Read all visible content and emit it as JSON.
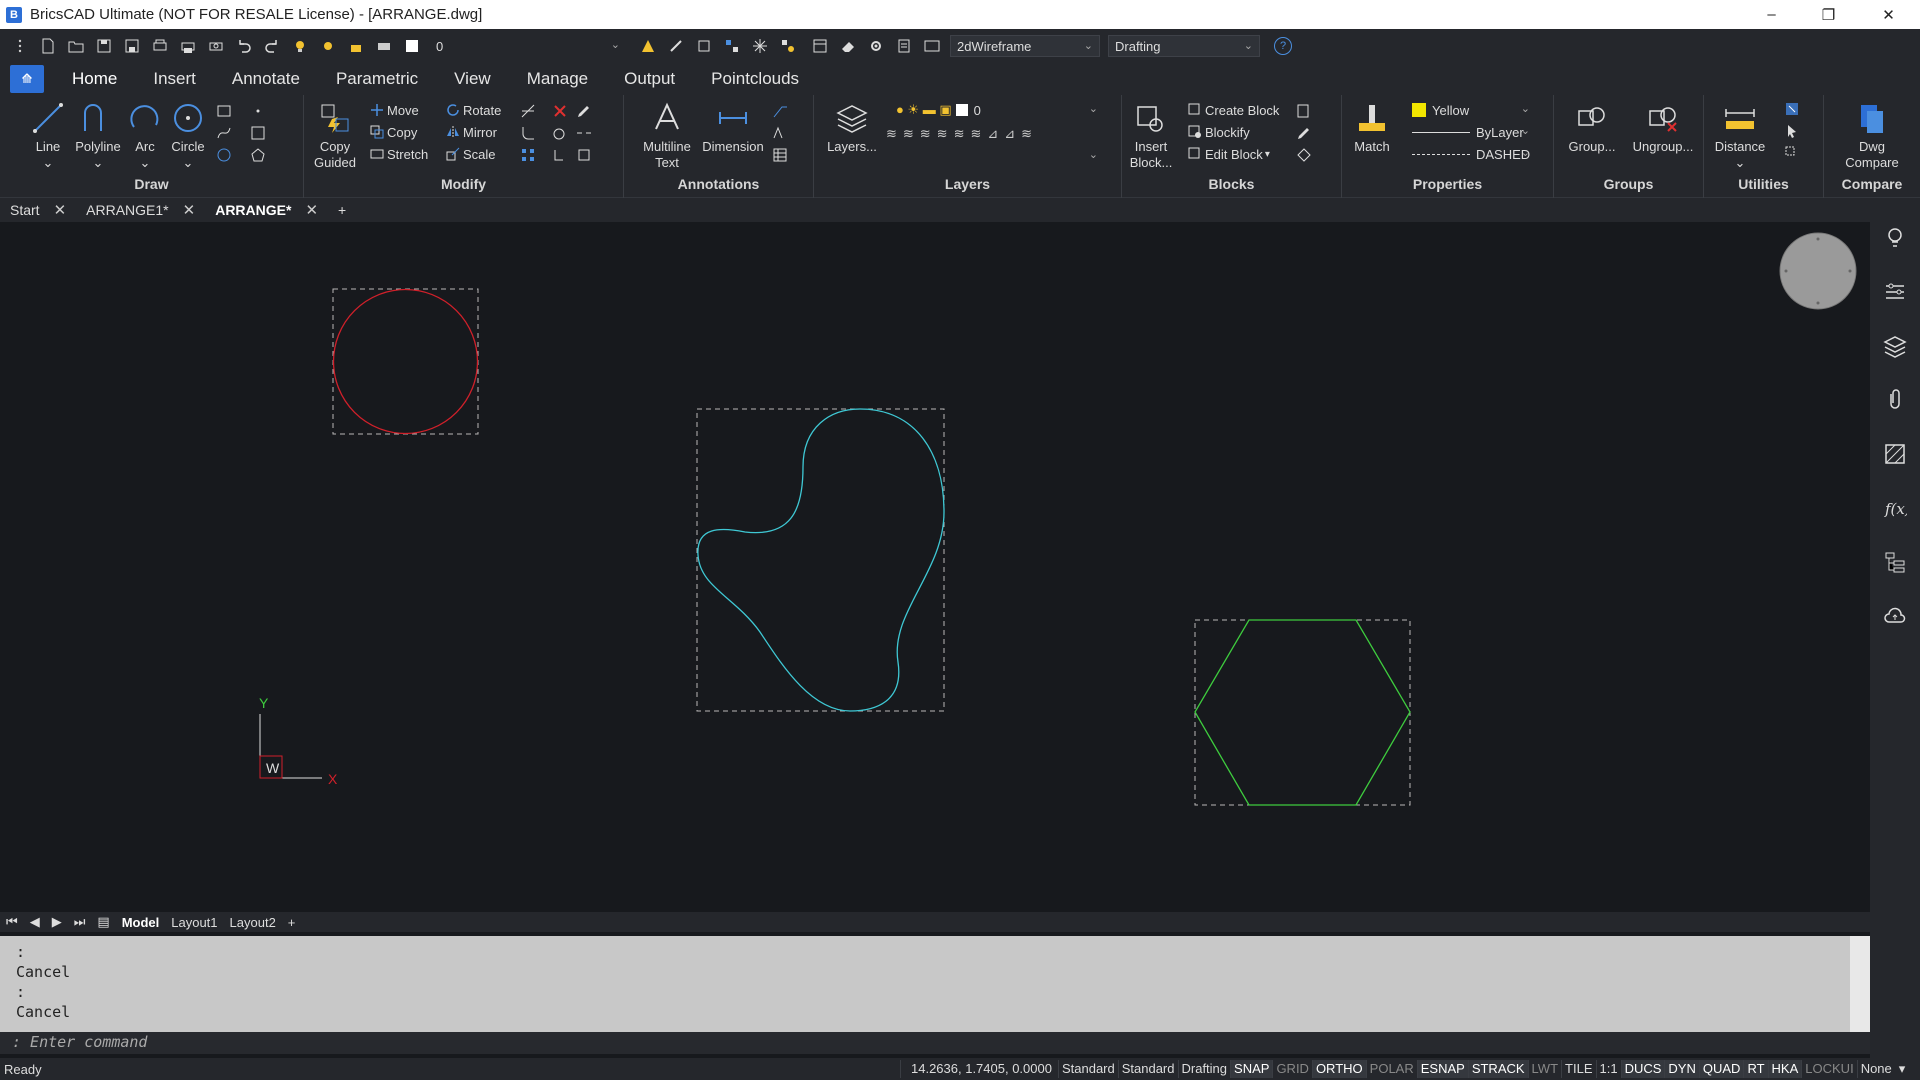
{
  "window": {
    "title": "BricsCAD Ultimate (NOT FOR RESALE License) - [ARRANGE.dwg]",
    "minimize": "–",
    "maximize": "❐",
    "close": "✕"
  },
  "qat": {
    "layer_value": "0",
    "visual_style": "2dWireframe",
    "workspace": "Drafting",
    "help": "?"
  },
  "menu": {
    "tabs": [
      "Home",
      "Insert",
      "Annotate",
      "Parametric",
      "View",
      "Manage",
      "Output",
      "Pointclouds"
    ]
  },
  "ribbon": {
    "draw": {
      "label": "Draw",
      "line": "Line",
      "polyline": "Polyline",
      "arc": "Arc",
      "circle": "Circle"
    },
    "modify": {
      "label": "Modify",
      "copy_guided": "Copy\nGuided",
      "move": "Move",
      "copy": "Copy",
      "stretch": "Stretch",
      "rotate": "Rotate",
      "mirror": "Mirror",
      "scale": "Scale"
    },
    "annotations": {
      "label": "Annotations",
      "mtext": "Multiline\nText",
      "dimension": "Dimension"
    },
    "layers": {
      "label": "Layers",
      "layers_btn": "Layers...",
      "layer_value": "0"
    },
    "blocks": {
      "label": "Blocks",
      "insert": "Insert\nBlock...",
      "create": "Create Block",
      "blockify": "Blockify",
      "edit": "Edit Block"
    },
    "properties": {
      "label": "Properties",
      "match": "Match",
      "color": "Yellow",
      "lineweight": "ByLayer",
      "linetype": "DASHED"
    },
    "groups": {
      "label": "Groups",
      "group": "Group...",
      "ungroup": "Ungroup..."
    },
    "utilities": {
      "label": "Utilities",
      "distance": "Distance"
    },
    "compare": {
      "label": "Compare",
      "dwg_compare": "Dwg\nCompare"
    }
  },
  "doc_tabs": [
    {
      "label": "Start",
      "close": "✕"
    },
    {
      "label": "ARRANGE1*",
      "close": "✕"
    },
    {
      "label": "ARRANGE*",
      "close": "✕"
    }
  ],
  "doc_tab_add": "+",
  "ucs": {
    "y": "Y",
    "x": "X",
    "w": "W"
  },
  "layout_tabs": {
    "nav": [
      "⏮",
      "◀",
      "▶",
      "⏭"
    ],
    "tabs": [
      "Model",
      "Layout1",
      "Layout2"
    ],
    "add": "+"
  },
  "command": {
    "history": [
      ":",
      "Cancel",
      ":",
      "Cancel"
    ],
    "placeholder": ": Enter command"
  },
  "status": {
    "ready": "Ready",
    "coords": "14.2636, 1.7405, 0.0000",
    "items": [
      {
        "t": "Standard",
        "s": "n"
      },
      {
        "t": "Standard",
        "s": "n"
      },
      {
        "t": "Drafting",
        "s": "n"
      },
      {
        "t": "SNAP",
        "s": "on"
      },
      {
        "t": "GRID",
        "s": "off"
      },
      {
        "t": "ORTHO",
        "s": "on"
      },
      {
        "t": "POLAR",
        "s": "off"
      },
      {
        "t": "ESNAP",
        "s": "on"
      },
      {
        "t": "STRACK",
        "s": "on"
      },
      {
        "t": "LWT",
        "s": "off"
      },
      {
        "t": "TILE",
        "s": "n"
      },
      {
        "t": "1:1",
        "s": "n"
      },
      {
        "t": "DUCS",
        "s": "on"
      },
      {
        "t": "DYN",
        "s": "on"
      },
      {
        "t": "QUAD",
        "s": "on"
      },
      {
        "t": "RT",
        "s": "on"
      },
      {
        "t": "HKA",
        "s": "on"
      },
      {
        "t": "LOCKUI",
        "s": "off"
      },
      {
        "t": "None",
        "s": "n"
      }
    ]
  },
  "colors": {
    "circle": "#d0202a",
    "blob": "#3fc8d4",
    "hexagon": "#3ecc3e",
    "accent": "#2d6fd6"
  }
}
